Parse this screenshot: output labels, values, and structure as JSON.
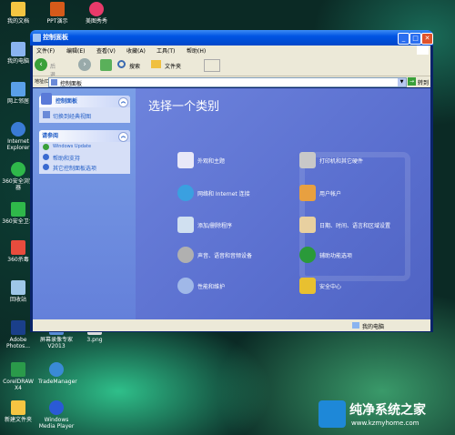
{
  "desktop": {
    "icons": [
      {
        "label": "我的文档",
        "color": "#f5c542"
      },
      {
        "label": "我的电脑",
        "color": "#8ab4f0"
      },
      {
        "label": "网上邻居",
        "color": "#5aa0e8"
      },
      {
        "label": "Internet Explorer",
        "color": "#3a7bd5"
      },
      {
        "label": "360安全浏览器",
        "color": "#2fb84a"
      },
      {
        "label": "360安全卫士",
        "color": "#2fb84a"
      },
      {
        "label": "360杀毒",
        "color": "#e84c3d"
      },
      {
        "label": "回收站",
        "color": "#9ec7e8"
      },
      {
        "label": "Adobe Photos...",
        "color": "#1a3f8a"
      },
      {
        "label": "屏幕录像专家V2013",
        "color": "#5a8ed6"
      },
      {
        "label": "3.png",
        "color": "#dddddd"
      },
      {
        "label": "CorelDRAW X4",
        "color": "#2a9a4a"
      },
      {
        "label": "TradeManager",
        "color": "#3a8ad6"
      },
      {
        "label": "新建文件夹",
        "color": "#f5c542"
      },
      {
        "label": "Windows Media Player",
        "color": "#2a5ad6"
      },
      {
        "label": "PPT演示",
        "color": "#d65a1a"
      },
      {
        "label": "美图秀秀",
        "color": "#e83a6a"
      }
    ]
  },
  "window": {
    "title": "控制面板",
    "menu": [
      "文件(F)",
      "编辑(E)",
      "查看(V)",
      "收藏(A)",
      "工具(T)",
      "帮助(H)"
    ],
    "toolbar": {
      "back": "后退",
      "search": "搜索",
      "folders": "文件夹"
    },
    "address": {
      "label": "地址(D)",
      "value": "控制面板",
      "go": "转到"
    },
    "left_panel": {
      "control_panel": {
        "title": "控制面板",
        "link": "切换到经典视图"
      },
      "see_also": {
        "title": "请参阅",
        "links": [
          "Windows Update",
          "帮助和支持",
          "其它控制面板选项"
        ]
      }
    },
    "main": {
      "heading": "选择一个类别",
      "categories": [
        {
          "label": "外观和主题",
          "icon": "appearance-icon",
          "color": "#e8e8f8"
        },
        {
          "label": "打印机和其它硬件",
          "icon": "printer-icon",
          "color": "#c8c8c8"
        },
        {
          "label": "网络和 Internet 连接",
          "icon": "network-icon",
          "color": "#3aa0e0"
        },
        {
          "label": "用户帐户",
          "icon": "users-icon",
          "color": "#e8a040"
        },
        {
          "label": "添加/删除程序",
          "icon": "add-remove-icon",
          "color": "#d0e0f0"
        },
        {
          "label": "日期、时间、语言和区域设置",
          "icon": "datetime-icon",
          "color": "#e8d0a0"
        },
        {
          "label": "声音、语音和音频设备",
          "icon": "sound-icon",
          "color": "#b0b0b0"
        },
        {
          "label": "辅助功能选项",
          "icon": "accessibility-icon",
          "color": "#2a9a3a"
        },
        {
          "label": "性能和维护",
          "icon": "performance-icon",
          "color": "#a0b8e8"
        },
        {
          "label": "安全中心",
          "icon": "shield-icon",
          "color": "#e8c030"
        }
      ]
    },
    "status": "我的电脑"
  },
  "watermark": {
    "title": "纯净系统之家",
    "url": "www.kzmyhome.com"
  }
}
